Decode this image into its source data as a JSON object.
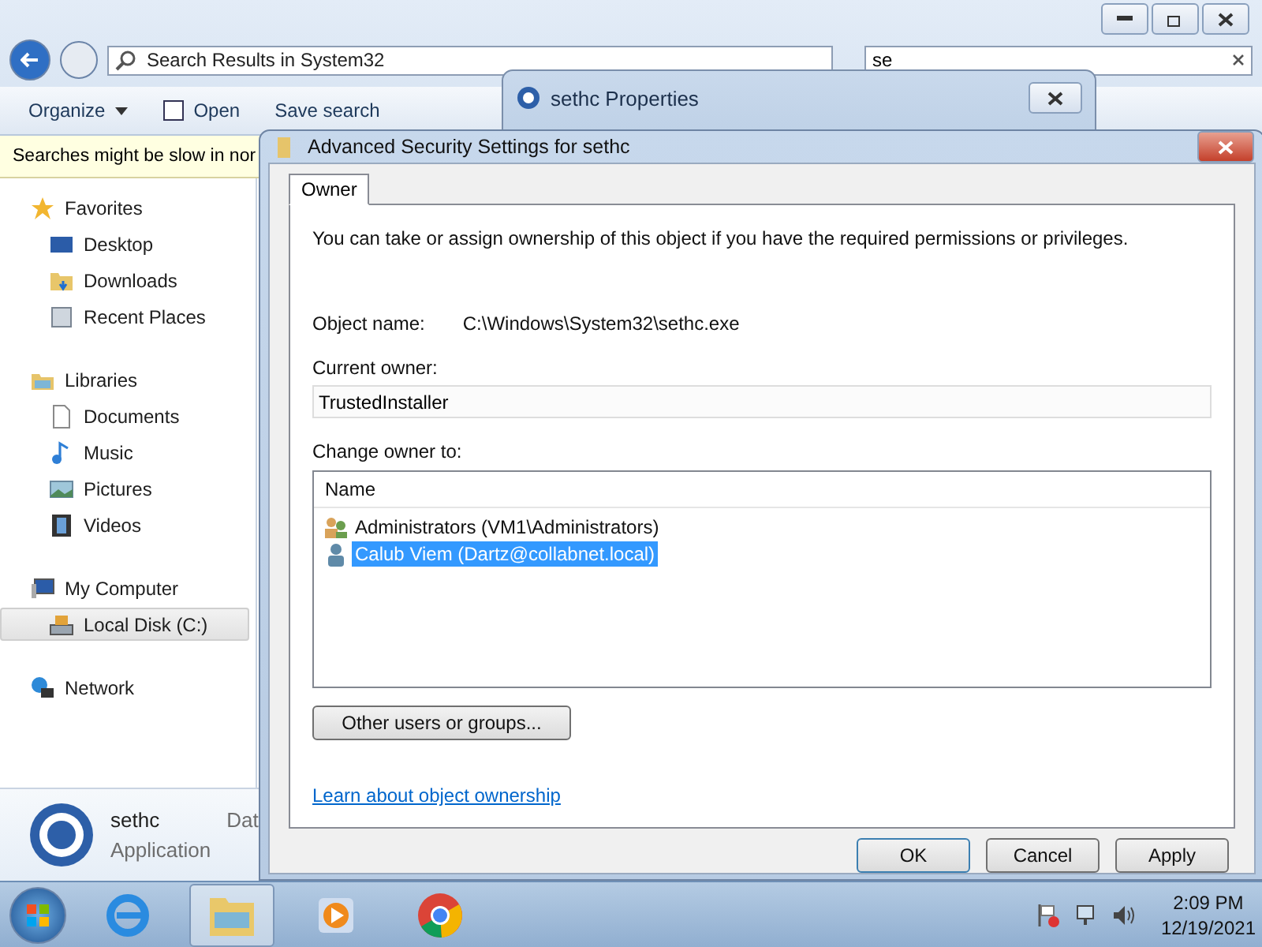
{
  "explorer": {
    "address": "Search Results in System32",
    "search": {
      "value": "se"
    },
    "toolbar": [
      "Organize",
      "Open",
      "Save search"
    ],
    "infobar": "Searches might be slow in nor",
    "nav": [
      {
        "label": "Favorites",
        "selected": false,
        "children": [
          {
            "label": "Desktop",
            "selected": false
          },
          {
            "label": "Downloads",
            "selected": false
          },
          {
            "label": "Recent Places",
            "selected": false
          }
        ]
      },
      {
        "label": "Libraries",
        "selected": false,
        "children": [
          {
            "label": "Documents",
            "selected": false
          },
          {
            "label": "Music",
            "selected": false
          },
          {
            "label": "Pictures",
            "selected": false
          },
          {
            "label": "Videos",
            "selected": false
          }
        ]
      },
      {
        "label": "My Computer",
        "selected": false,
        "children": [
          {
            "label": "Local Disk (C:)",
            "selected": true
          }
        ]
      },
      {
        "label": "Network",
        "selected": false
      }
    ],
    "details": {
      "name": "sethc",
      "type": "Application",
      "column": "Dat"
    }
  },
  "properties": {
    "title": "sethc Properties"
  },
  "dialog": {
    "title": "Advanced Security Settings for sethc",
    "tabs": [
      {
        "label": "Owner",
        "selected": true
      }
    ],
    "intro": "You can take or assign ownership of this object if you have the required permissions or privileges.",
    "object_label": "Object name:",
    "object_name": "C:\\Windows\\System32\\sethc.exe",
    "owner_label": "Current owner:",
    "owner": "TrustedInstaller",
    "change_label": "Change owner to:",
    "column": "Name",
    "owners": [
      {
        "name": "Administrators (VM1\\Administrators)",
        "kind": "group",
        "selected": false
      },
      {
        "name": "Calub Viem (Dartz@collabnet.local)",
        "kind": "user",
        "selected": true
      }
    ],
    "other_button": "Other users or groups...",
    "link": "Learn about object ownership",
    "buttons": [
      "OK",
      "Cancel",
      "Apply"
    ]
  },
  "taskbar": {
    "apps": [
      {
        "selected": false
      },
      {
        "selected": true
      },
      {
        "selected": false
      },
      {
        "selected": false
      }
    ],
    "time": "2:09 PM",
    "date": "12/19/2021"
  }
}
